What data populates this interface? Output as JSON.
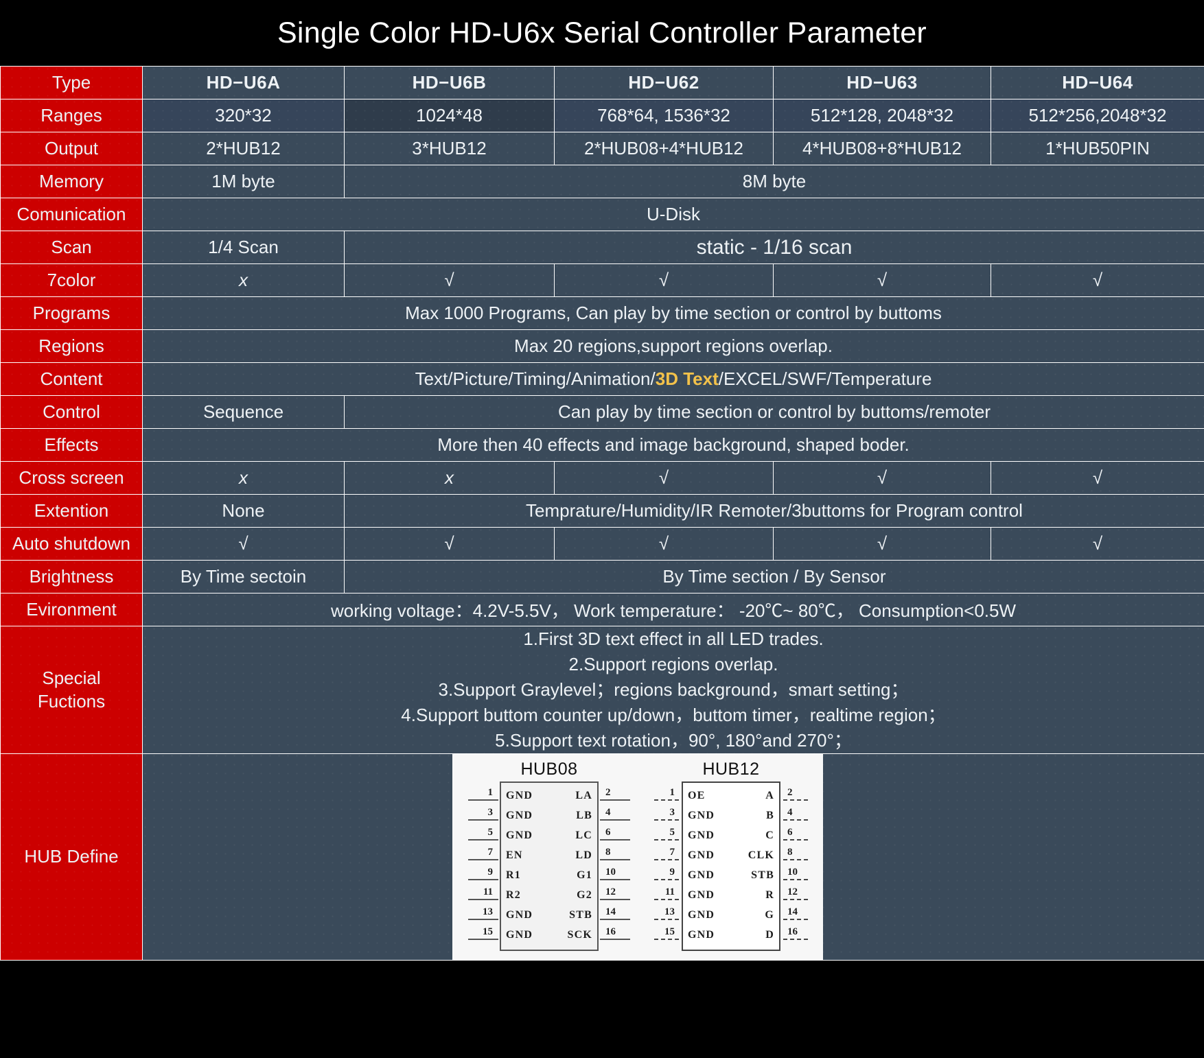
{
  "title": "Single Color HD-U6x Serial Controller Parameter",
  "table": {
    "columns": [
      "HD−U6A",
      "HD−U6B",
      "HD−U62",
      "HD−U63",
      "HD−U64"
    ],
    "row_labels": {
      "type": "Type",
      "ranges": "Ranges",
      "output": "Output",
      "memory": "Memory",
      "comunication": "Comunication",
      "scan": "Scan",
      "sevencolor": "7color",
      "programs": "Programs",
      "regions": "Regions",
      "content": "Content",
      "control": "Control",
      "effects": "Effects",
      "cross_screen": "Cross screen",
      "extention": "Extention",
      "auto_shutdown": "Auto shutdown",
      "brightness": "Brightness",
      "evironment": "Evironment",
      "special_fuctions_line1": "Special",
      "special_fuctions_line2": "Fuctions",
      "hub_define": "HUB Define"
    },
    "ranges": [
      "320*32",
      "1024*48",
      "768*64,  1536*32",
      "512*128,  2048*32",
      "512*256,2048*32"
    ],
    "output": [
      "2*HUB12",
      "3*HUB12",
      "2*HUB08+4*HUB12",
      "4*HUB08+8*HUB12",
      "1*HUB50PIN"
    ],
    "memory": {
      "first": "1M byte",
      "rest": "8M byte"
    },
    "comunication": "U-Disk",
    "scan": {
      "first": "1/4 Scan",
      "rest": "static - 1/16 scan"
    },
    "sevencolor": [
      "x",
      "√",
      "√",
      "√",
      "√"
    ],
    "programs": "Max 1000 Programs,   Can play by time section or control by buttoms",
    "regions": "Max 20 regions,support regions overlap.",
    "content": {
      "before": "Text/Picture/Timing/Animation/",
      "accent": "3D Text",
      "after": "/EXCEL/SWF/Temperature"
    },
    "control": {
      "first": "Sequence",
      "rest": "Can play by time section or control by buttoms/remoter"
    },
    "effects": "More then 40 effects and image background, shaped boder.",
    "cross_screen": [
      "x",
      "x",
      "√",
      "√",
      "√"
    ],
    "extention": {
      "first": "None",
      "rest": "Temprature/Humidity/IR Remoter/3buttoms for Program control"
    },
    "auto_shutdown": [
      "√",
      "√",
      "√",
      "√",
      "√"
    ],
    "brightness": {
      "first": "By Time sectoin",
      "rest": "By Time section / By Sensor"
    },
    "evironment": "working voltage：4.2V-5.5V， Work temperature： -20℃~ 80℃， Consumption<0.5W",
    "special_fuctions": [
      "1.First 3D text effect in all LED trades.",
      "2.Support regions overlap.",
      "3.Support Graylevel；regions background，smart setting；",
      "4.Support buttom counter up/down，buttom timer，realtime region；",
      "5.Support text rotation，90°, 180°and 270°；"
    ]
  },
  "hub_diagrams": {
    "hub08": {
      "title": "HUB08",
      "pins": [
        {
          "left_num": "1",
          "left_name": "GND",
          "right_name": "LA",
          "right_num": "2"
        },
        {
          "left_num": "3",
          "left_name": "GND",
          "right_name": "LB",
          "right_num": "4"
        },
        {
          "left_num": "5",
          "left_name": "GND",
          "right_name": "LC",
          "right_num": "6"
        },
        {
          "left_num": "7",
          "left_name": "EN",
          "right_name": "LD",
          "right_num": "8"
        },
        {
          "left_num": "9",
          "left_name": "R1",
          "right_name": "G1",
          "right_num": "10"
        },
        {
          "left_num": "11",
          "left_name": "R2",
          "right_name": "G2",
          "right_num": "12"
        },
        {
          "left_num": "13",
          "left_name": "GND",
          "right_name": "STB",
          "right_num": "14"
        },
        {
          "left_num": "15",
          "left_name": "GND",
          "right_name": "SCK",
          "right_num": "16"
        }
      ]
    },
    "hub12": {
      "title": "HUB12",
      "pins": [
        {
          "left_num": "1",
          "left_name": "OE",
          "right_name": "A",
          "right_num": "2"
        },
        {
          "left_num": "3",
          "left_name": "GND",
          "right_name": "B",
          "right_num": "4"
        },
        {
          "left_num": "5",
          "left_name": "GND",
          "right_name": "C",
          "right_num": "6"
        },
        {
          "left_num": "7",
          "left_name": "GND",
          "right_name": "CLK",
          "right_num": "8"
        },
        {
          "left_num": "9",
          "left_name": "GND",
          "right_name": "STB",
          "right_num": "10"
        },
        {
          "left_num": "11",
          "left_name": "GND",
          "right_name": "R",
          "right_num": "12"
        },
        {
          "left_num": "13",
          "left_name": "GND",
          "right_name": "G",
          "right_num": "14"
        },
        {
          "left_num": "15",
          "left_name": "GND",
          "right_name": "D",
          "right_num": "16"
        }
      ]
    }
  },
  "colors": {
    "accent_red": "#cc0000",
    "panel_blue": "#3a4a5a",
    "title_bg": "#000000",
    "highlight_yellow": "#f2c14a",
    "ranges_border_green": "#4a9a62"
  }
}
